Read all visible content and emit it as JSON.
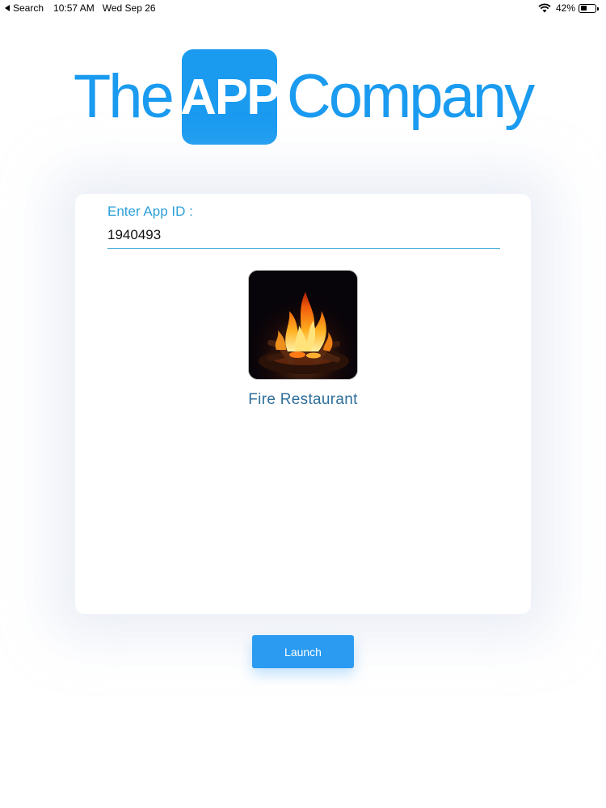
{
  "status_bar": {
    "back_label": "Search",
    "time": "10:57 AM",
    "date": "Wed Sep 26",
    "battery_percent": "42%",
    "battery_level": 0.42,
    "wifi_icon": "wifi-icon",
    "battery_icon": "battery-icon"
  },
  "logo": {
    "word_1": "The",
    "box_word": "APP",
    "word_2": "Company",
    "brand_color": "#1a9bf0"
  },
  "form": {
    "app_id_label": "Enter App ID :",
    "app_id_value": "1940493"
  },
  "app_result": {
    "name": "Fire Restaurant",
    "icon": "campfire-image"
  },
  "launch_button": {
    "label": "Launch",
    "color": "#2a9bf1"
  }
}
